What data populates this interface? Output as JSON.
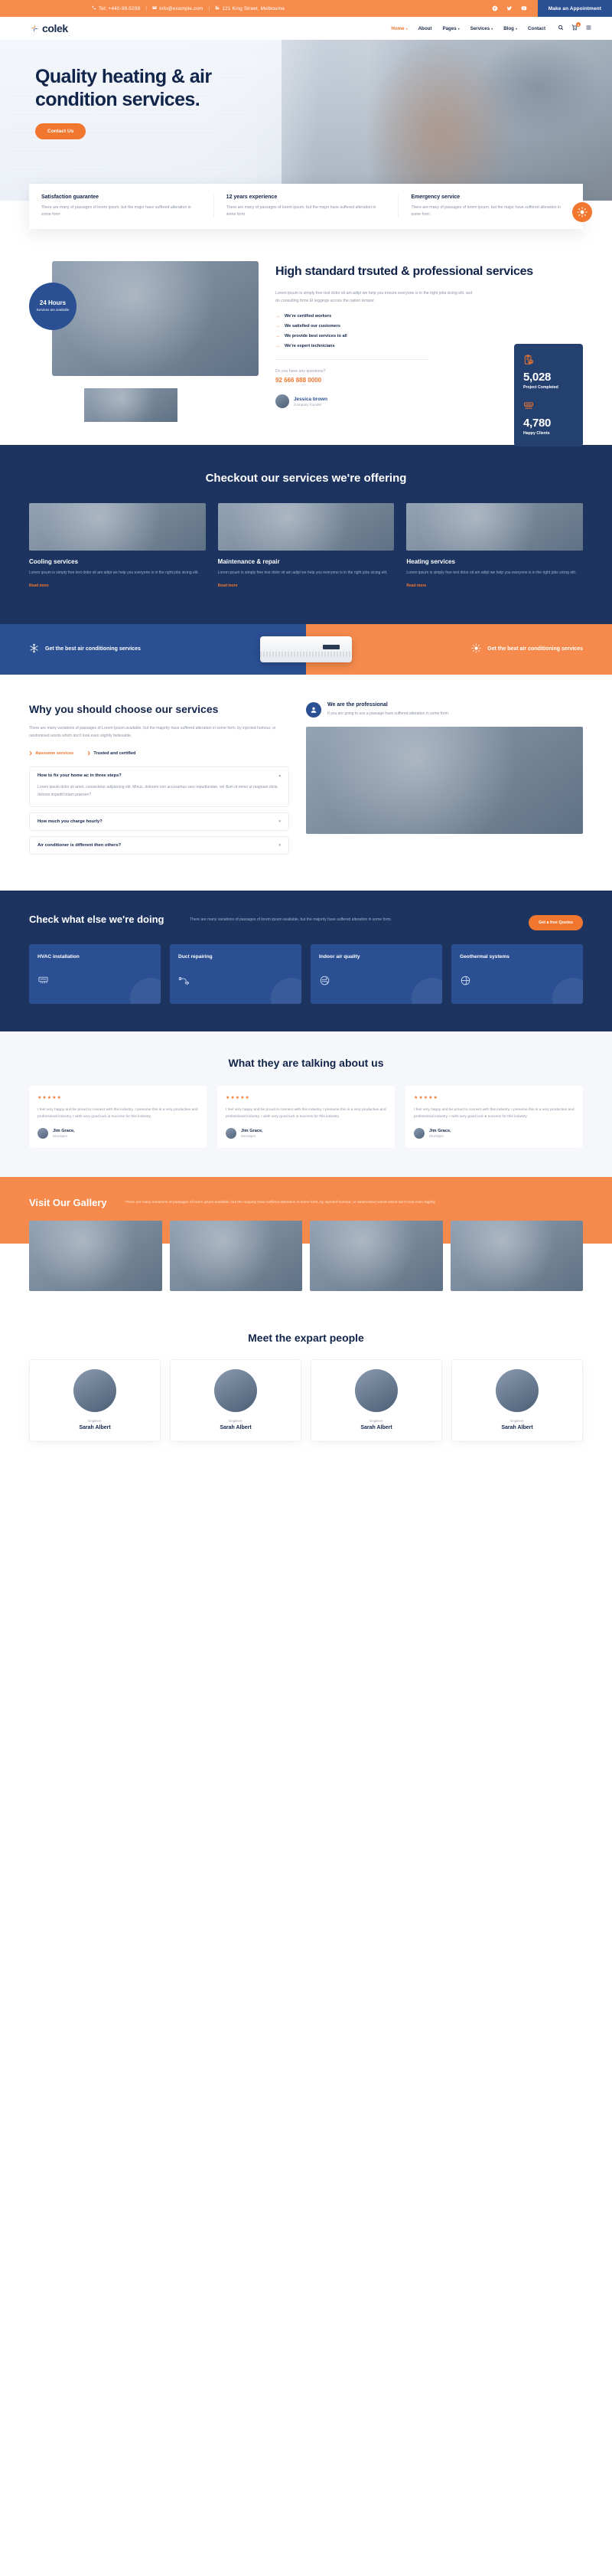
{
  "topbar": {
    "phone_icon": "phone-icon",
    "phone": "Tel: +440-98-5298",
    "email_icon": "mail-icon",
    "email": "info@example.com",
    "address_icon": "building-icon",
    "address": "121 King Street, Melbourne",
    "socials": [
      "facebook-icon",
      "twitter-icon",
      "youtube-icon"
    ],
    "appointment_label": "Make an Appointment"
  },
  "nav": {
    "brand": "colek",
    "items": [
      {
        "label": "Home",
        "caret": true,
        "active": true
      },
      {
        "label": "About",
        "caret": false,
        "active": false
      },
      {
        "label": "Pages",
        "caret": true,
        "active": false
      },
      {
        "label": "Services",
        "caret": true,
        "active": false
      },
      {
        "label": "Blog",
        "caret": true,
        "active": false
      },
      {
        "label": "Contact",
        "caret": false,
        "active": false
      }
    ],
    "search_icon": "search-icon",
    "cart_icon": "cart-icon",
    "cart_count": "0",
    "menu_icon": "hamburger-icon"
  },
  "hero": {
    "title": "Quality heating & air condition services.",
    "cta": "Contact Us"
  },
  "features": [
    {
      "title": "Satisfaction guarantee",
      "text": "There are many of passages of lorem ipsum, but the major have suffered alteration in some form"
    },
    {
      "title": "12 years experience",
      "text": "There are many of passages of lorem ipsum, but the major have suffered alteration in some form"
    },
    {
      "title": "Emergency service",
      "text": "There are many of passages of lorem ipsum, but the major have suffered alteration in some form"
    }
  ],
  "about": {
    "badge_title": "24 Hours",
    "badge_sub": "Services are available",
    "heading": "High standard trsuted & professional services",
    "paragraph": "Lorem ipsum is simply free text dolor sit am adipi we help you ensure everyone is in the right jobs sicing elit, sed do consulting firms Et leggings across the nation tempor.",
    "checks": [
      "We're certified workers",
      "We satisfied our customers",
      "We provide best services to all",
      "We're expert technicians"
    ],
    "question": "Do you have any questions?",
    "phone": "92 666 888 0000",
    "founder_name": "Jessica brown",
    "founder_role": "Company founder",
    "stats": [
      {
        "icon": "clipboard-icon",
        "value": "5,028",
        "label": "Project Completed"
      },
      {
        "icon": "ac-unit-icon",
        "value": "4,780",
        "label": "Happy Clients"
      }
    ]
  },
  "services": {
    "heading": "Checkout our services we're offering",
    "items": [
      {
        "title": "Cooling services",
        "text": "Lorem ipsum is simply free text dolor sit am adipi we help you everyone is in the right jobs sicing elit.",
        "more": "Read more"
      },
      {
        "title": "Maintenance & repair",
        "text": "Lorem ipsum is simply free text dolor sit am adipi we help you everyone is in the right jobs sicing elit.",
        "more": "Read more"
      },
      {
        "title": "Heating services",
        "text": "Lorem ipsum is simply free text dolor sit am adipi we help you everyone is in the right jobs sicing elit.",
        "more": "Read more"
      }
    ]
  },
  "split": {
    "left_icon": "snowflake-icon",
    "left_text": "Get the best air conditioning services",
    "right_icon": "sun-icon",
    "right_text": "Get the best air conditioning services"
  },
  "why": {
    "heading": "Why you should choose our services",
    "paragraph": "There are many variations of passages of Lorem Ipsum available, but the majority have suffered alteration in some form, by injected humour, or randomised words which don't look even slightly believable.",
    "tabs": [
      {
        "label": "Awesome services",
        "on": true
      },
      {
        "label": "Trusted and certified",
        "on": false
      }
    ],
    "accordion": [
      {
        "q": "How to fix your home ac in three steps?",
        "a": "Lorem ipsum dolor sit amet, consectetur adipisicing elit. Minus, dolorem non accusamus vero repudiandae, vel illum id nemo ut magnam dicta dolores impedit totam praesen?",
        "open": true
      },
      {
        "q": "How much you charge hourly?",
        "a": "",
        "open": false
      },
      {
        "q": "Air conditioner is different then others?",
        "a": "",
        "open": false
      }
    ],
    "pro_icon": "user-icon",
    "pro_title": "We are the professional",
    "pro_text": "If you are going to use a passage have suffered alteration in some form."
  },
  "cwe": {
    "heading": "Check what else we're doing",
    "paragraph": "There are many variations of passages of lorem ipsum available, but the majority have suffered alteration in some form.",
    "cta": "Get a free Quotes",
    "cards": [
      {
        "title": "HVAC installation",
        "icon": "hvac-icon"
      },
      {
        "title": "Duct repairing",
        "icon": "duct-icon"
      },
      {
        "title": "Indoor air quality",
        "icon": "air-quality-icon"
      },
      {
        "title": "Geothermal systems",
        "icon": "geothermal-icon"
      }
    ]
  },
  "testimonials": {
    "heading": "What they are talking about us",
    "items": [
      {
        "stars": "★★★★★",
        "text": "I feel very happy and be proud to connect with this industry. I presume this is a very productive and professional industry. I wish very good luck & success for this industry.",
        "name": "Jim Grace,",
        "role": "Developer"
      },
      {
        "stars": "★★★★★",
        "text": "I feel very happy and be proud to connect with this industry. I presume this is a very productive and professional industry. I wish very good luck & success for this industry.",
        "name": "Jim Grace,",
        "role": "Developer"
      },
      {
        "stars": "★★★★★",
        "text": "I feel very happy and be proud to connect with this industry. I presume this is a very productive and professional industry. I wish very good luck & success for this industry.",
        "name": "Jim Grace,",
        "role": "Developer"
      }
    ]
  },
  "gallery": {
    "heading": "Visit Our Gallery",
    "paragraph": "There are many variations of passages of lorem ipsum available, but the majority have suffered alteration in some form, by injected humour, or randomised words which don't look even slightly.",
    "count": 4
  },
  "team": {
    "heading": "Meet the expart people",
    "members": [
      {
        "role": "Engineer",
        "name": "Sarah Albert"
      },
      {
        "role": "Engineer",
        "name": "Sarah Albert"
      },
      {
        "role": "Engineer",
        "name": "Sarah Albert"
      },
      {
        "role": "Engineer",
        "name": "Sarah Albert"
      }
    ]
  },
  "colors": {
    "orange": "#f1762e",
    "orange_light": "#f58a4c",
    "navy": "#1d3460",
    "blue": "#2b4f93",
    "dark_text": "#11244a",
    "muted": "#8b93a3"
  }
}
